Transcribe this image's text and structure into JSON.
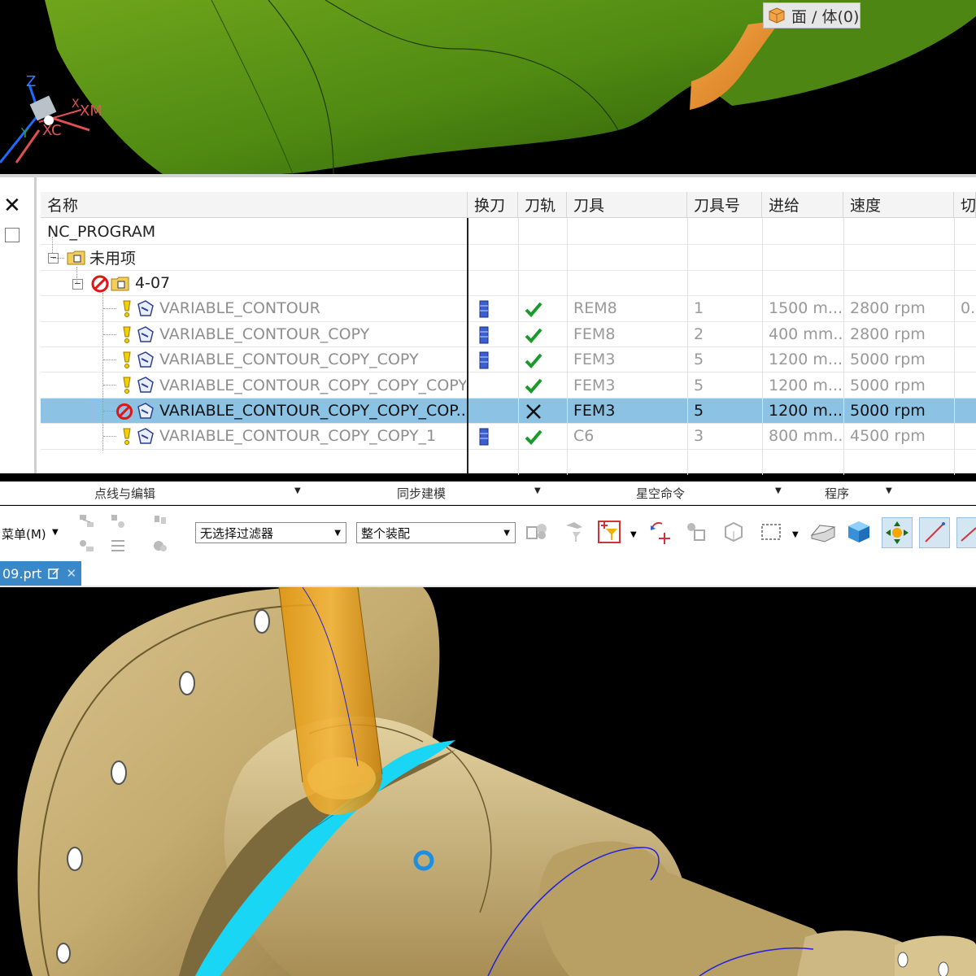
{
  "selection_badge": {
    "label": "面 / 体(0)"
  },
  "top_view": {
    "axis_labels": {
      "z": "Z",
      "y": "Y",
      "xc": "XC",
      "xm": "XM",
      "xm_prefix": "X"
    }
  },
  "navigator": {
    "columns": [
      "名称",
      "换刀",
      "刀轨",
      "刀具",
      "刀具号",
      "进给",
      "速度",
      "切"
    ],
    "root": "NC_PROGRAM",
    "group_unused": "未用项",
    "program": "4-07",
    "rows": [
      {
        "name": "VARIABLE_CONTOUR",
        "tool": "REM8",
        "tool_no": "1",
        "feed": "1500 m...",
        "speed": "2800 rpm",
        "extra": "0.",
        "toolchange": true,
        "path": "check"
      },
      {
        "name": "VARIABLE_CONTOUR_COPY",
        "tool": "FEM8",
        "tool_no": "2",
        "feed": "400 mm...",
        "speed": "2800 rpm",
        "extra": "",
        "toolchange": true,
        "path": "check"
      },
      {
        "name": "VARIABLE_CONTOUR_COPY_COPY",
        "tool": "FEM3",
        "tool_no": "5",
        "feed": "1200 m...",
        "speed": "5000 rpm",
        "extra": "",
        "toolchange": true,
        "path": "check"
      },
      {
        "name": "VARIABLE_CONTOUR_COPY_COPY_COPY",
        "tool": "FEM3",
        "tool_no": "5",
        "feed": "1200 m...",
        "speed": "5000 rpm",
        "extra": "",
        "toolchange": false,
        "path": "check"
      },
      {
        "name": "VARIABLE_CONTOUR_COPY_COPY_COP...",
        "tool": "FEM3",
        "tool_no": "5",
        "feed": "1200 m...",
        "speed": "5000 rpm",
        "extra": "",
        "toolchange": false,
        "path": "cross",
        "selected": true
      },
      {
        "name": "VARIABLE_CONTOUR_COPY_COPY_1",
        "tool": "C6",
        "tool_no": "3",
        "feed": "800 mm...",
        "speed": "4500 rpm",
        "extra": "",
        "toolchange": true,
        "path": "check"
      }
    ]
  },
  "ribbon": {
    "groups": [
      "点线与编辑",
      "同步建模",
      "星空命令",
      "程序"
    ]
  },
  "toolbar": {
    "menu_label": "菜单(M)",
    "filter_value": "无选择过滤器",
    "scope_value": "整个装配"
  },
  "file_tab": {
    "label": "09.prt"
  },
  "colors": {
    "selection": "#8cc3e4",
    "accent_blue": "#3b88c9",
    "check_green": "#1a9a2a",
    "part_brass": "#c9b27a",
    "toolpath_cyan": "#19d6f5",
    "tool_orange": "#e8a21a"
  }
}
